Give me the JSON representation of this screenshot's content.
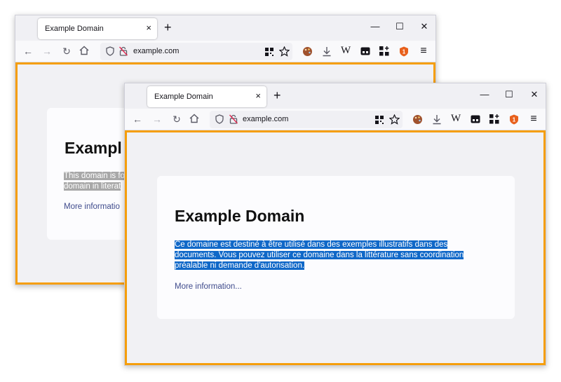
{
  "back_window": {
    "tab_title": "Example Domain",
    "url": "example.com",
    "heading": "Exampl",
    "paragraph_line1": "This domain is fo",
    "paragraph_line2": "domain in literat",
    "more_link": "More informatio"
  },
  "front_window": {
    "tab_title": "Example Domain",
    "url": "example.com",
    "heading": "Example Domain",
    "paragraph_line1": "Ce domaine est destiné à être utilisé dans des exemples illustratifs dans des",
    "paragraph_line2": "documents. Vous pouvez utiliser ce domaine dans la littérature sans coordination",
    "paragraph_line3": "préalable ni demande d'autorisation.",
    "more_link": "More information..."
  },
  "toolbar": {
    "tab_close": "×",
    "new_tab": "+",
    "minimize": "—",
    "maximize": "☐",
    "close": "✕",
    "back": "←",
    "forward": "→",
    "reload": "↻",
    "wikipedia": "W",
    "menu": "≡"
  },
  "colors": {
    "highlight_border": "#f59e0b",
    "selection_inactive": "#a8a8a8",
    "selection_active": "#1068c8",
    "link": "#3f4b8c"
  }
}
